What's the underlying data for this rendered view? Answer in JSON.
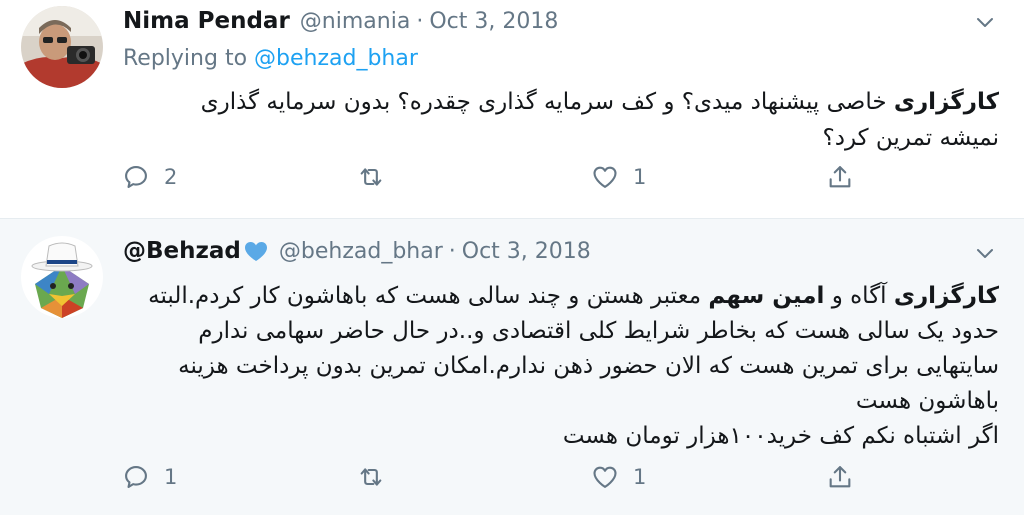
{
  "tweets": [
    {
      "name": "Nima Pendar",
      "handle": "@nimania",
      "separator": "·",
      "date": "Oct 3, 2018",
      "replying_prefix": "Replying to",
      "replying_to": "@behzad_bhar",
      "body_bold": "کارگزاری",
      "body_text": " خاصی پیشنهاد میدی؟ و کف سرمایه گذاری چقدره؟ بدون سرمایه گذاری نمیشه تمرین کرد؟",
      "reply_count": "2",
      "retweet_count": "",
      "like_count": "1"
    },
    {
      "name": "@Behzad",
      "handle": "@behzad_bhar",
      "separator": "·",
      "date": "Oct 3, 2018",
      "body_bold1": "کارگزاری",
      "body_text1": " آگاه و ",
      "body_bold2": "امین سهم",
      "body_text2": " معتبر هستن و چند سالی هست که باهاشون کار کردم.البته حدود یک سالی هست که بخاطر شرایط کلی اقتصادی و..در حال حاضر سهامی ندارم سایتهایی برای تمرین هست که الان حضور ذهن ندارم.امکان تمرین بدون پرداخت هزینه باهاشون هست",
      "body_line2": "اگر اشتباه نکم کف خرید۱۰۰هزار تومان هست",
      "reply_count": "1",
      "retweet_count": "",
      "like_count": "1"
    }
  ],
  "icons": {
    "reply": "reply-icon",
    "retweet": "retweet-icon",
    "like": "heart-icon",
    "share": "share-icon",
    "more": "chevron-down-icon",
    "verified": "heart-badge-icon"
  },
  "colors": {
    "link": "#1da1f2",
    "muted": "#657786",
    "verified_heart": "#5aa9e6",
    "reply_bg": "#f5f8fa"
  }
}
